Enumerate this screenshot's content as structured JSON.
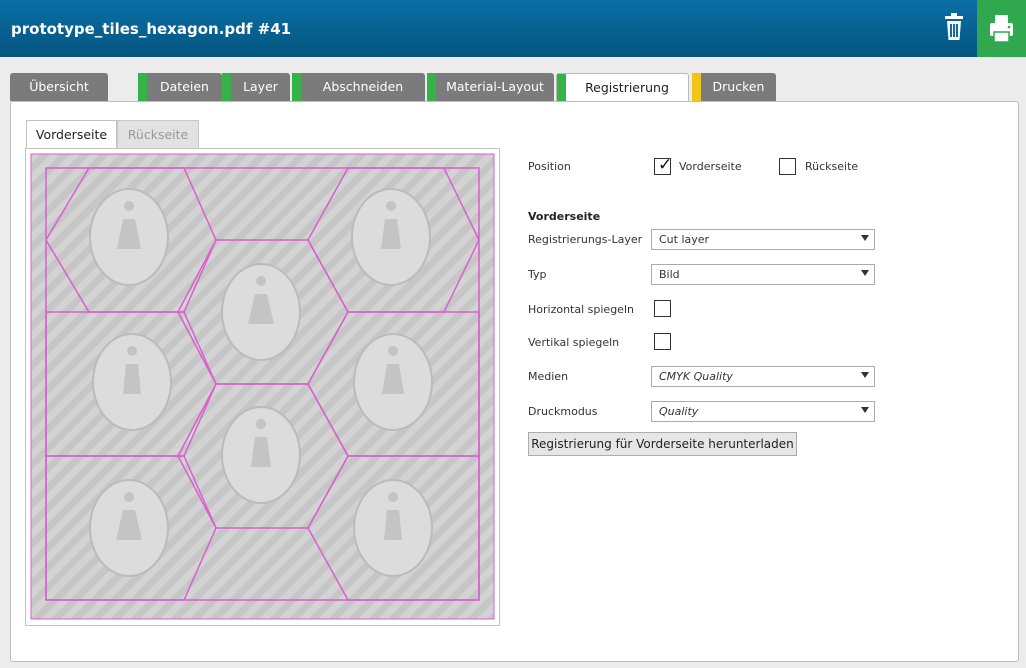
{
  "header": {
    "title": "prototype_tiles_hexagon.pdf #41",
    "delete_icon": "trash-icon",
    "print_icon": "printer-icon"
  },
  "tabs": [
    {
      "label": "Übersicht",
      "status": "none"
    },
    {
      "label": "Dateien",
      "status": "#36b24a"
    },
    {
      "label": "Layer",
      "status": "#36b24a"
    },
    {
      "label": "Abschneiden",
      "status": "#36b24a"
    },
    {
      "label": "Material-Layout",
      "status": "#36b24a"
    },
    {
      "label": "Registrierung",
      "status": "#36b24a"
    },
    {
      "label": "Drucken",
      "status": "#f0c419"
    }
  ],
  "subtabs": {
    "front": "Vorderseite",
    "back": "Rückseite"
  },
  "form": {
    "position_label": "Position",
    "front_checkbox_label": "Vorderseite",
    "front_checked": true,
    "back_checkbox_label": "Rückseite",
    "back_checked": false,
    "section_title": "Vorderseite",
    "reg_layer_label": "Registrierungs-Layer",
    "reg_layer_value": "Cut layer",
    "type_label": "Typ",
    "type_value": "Bild",
    "flip_h_label": "Horizontal spiegeln",
    "flip_v_label": "Vertikal spiegeln",
    "media_label": "Medien",
    "media_value": "CMYK Quality",
    "print_mode_label": "Druckmodus",
    "print_mode_value": "Quality",
    "download_button": "Registrierung für Vorderseite herunterladen"
  },
  "colors": {
    "header": "#0a6fa6",
    "print_button": "#2fa84f",
    "cut_lines": "#d95fcf"
  }
}
